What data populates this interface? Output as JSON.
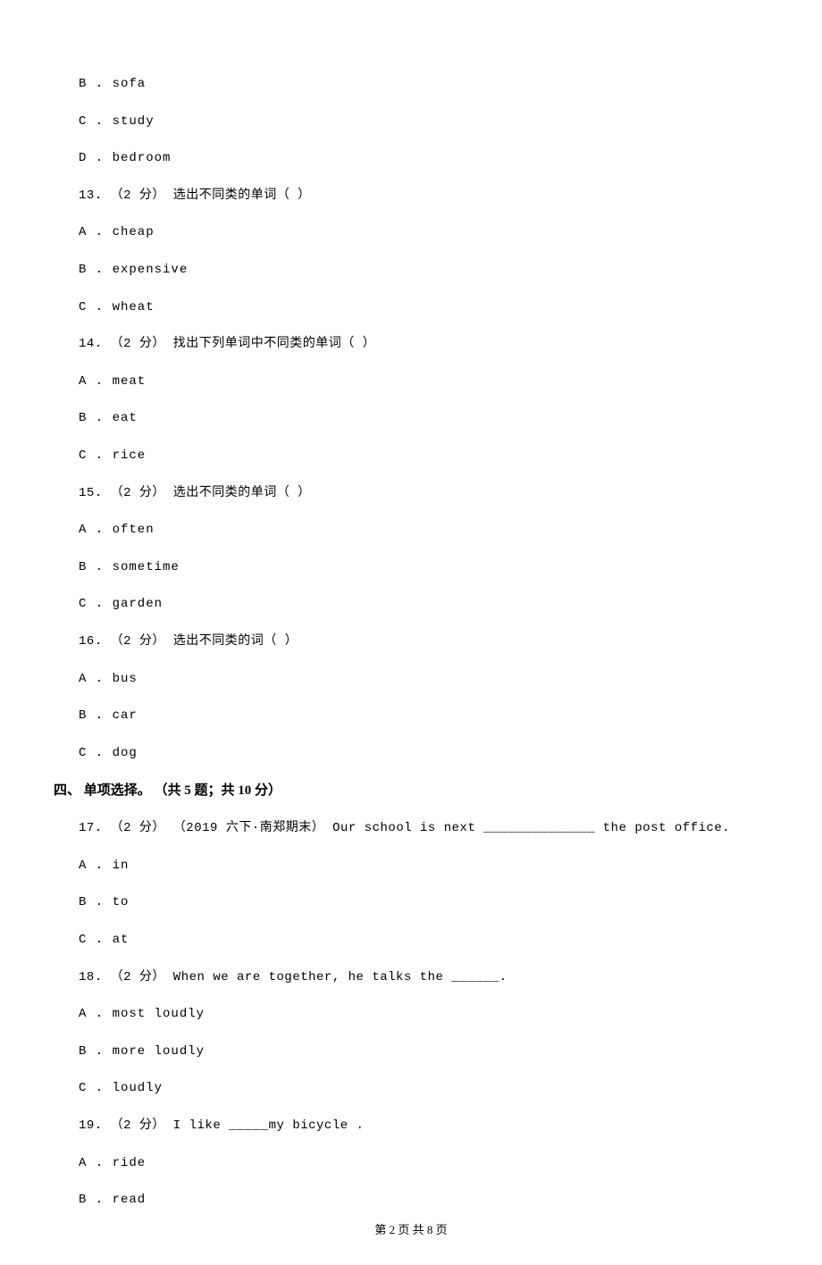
{
  "options_top": [
    "B . sofa",
    "C . study",
    "D . bedroom"
  ],
  "q13": {
    "stem": "13. （2 分） 选出不同类的单词（   ）",
    "options": [
      "A . cheap",
      "B . expensive",
      "C . wheat"
    ]
  },
  "q14": {
    "stem": "14. （2 分） 找出下列单词中不同类的单词（   ）",
    "options": [
      "A . meat",
      "B . eat",
      "C . rice"
    ]
  },
  "q15": {
    "stem": "15. （2 分） 选出不同类的单词（   ）",
    "options": [
      "A . often",
      "B . sometime",
      "C . garden"
    ]
  },
  "q16": {
    "stem": "16. （2 分） 选出不同类的词（   ）",
    "options": [
      "A . bus",
      "B . car",
      "C . dog"
    ]
  },
  "section4_heading": "四、 单项选择。 （共 5 题；共 10 分）",
  "q17": {
    "stem": "17. （2 分） （2019 六下·南郑期末） Our school is next ______________ the post office.",
    "options": [
      "A . in",
      "B . to",
      "C . at"
    ]
  },
  "q18": {
    "stem": "18. （2 分） When we are together, he talks the ______.",
    "options": [
      "A . most loudly",
      "B . more loudly",
      "C . loudly"
    ]
  },
  "q19": {
    "stem": "19. （2 分） I like _____my bicycle .",
    "options": [
      "A . ride",
      "B . read"
    ]
  },
  "footer": "第 2 页 共 8 页"
}
